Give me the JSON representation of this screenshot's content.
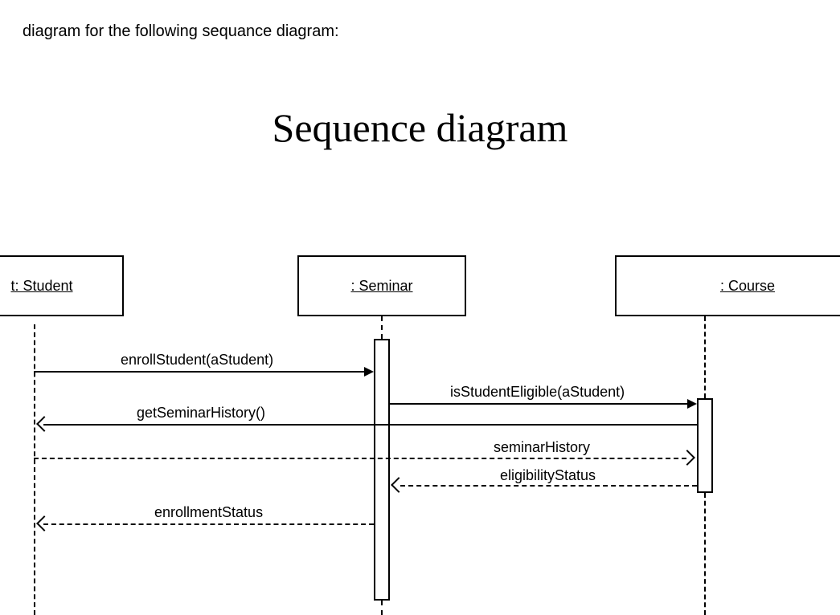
{
  "caption": "diagram for the following sequance diagram:",
  "title": "Sequence diagram",
  "lifelines": {
    "student": "t: Student",
    "seminar": ": Seminar",
    "course": ": Course"
  },
  "messages": {
    "m1": "enrollStudent(aStudent)",
    "m2": "isStudentEligible(aStudent)",
    "m3": "getSeminarHistory()",
    "m4": "seminarHistory",
    "m5": "eligibilityStatus",
    "m6": "enrollmentStatus"
  }
}
